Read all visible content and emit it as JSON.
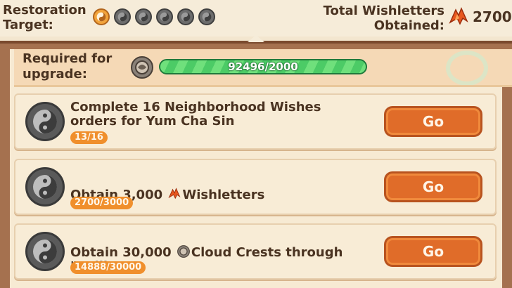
{
  "header": {
    "restoration_label": "Restoration\nTarget:",
    "orbs": [
      "active",
      "inactive",
      "inactive",
      "inactive",
      "inactive",
      "inactive"
    ],
    "total_label": "Total Wishletters\nObtained:",
    "total_value": "2700"
  },
  "requirement": {
    "label": "Required for\nupgrade:",
    "progress_text": "92496/2000",
    "progress_fraction": 1.0
  },
  "tasks": [
    {
      "title": "Complete 16 Neighborhood Wishes\norders for Yum Cha Sin",
      "progress": "13/16",
      "button": "Go"
    },
    {
      "title_before": "Obtain 3,000 ",
      "title_after": "Wishletters",
      "progress": "2700/3000",
      "button": "Go"
    },
    {
      "title_before": "Obtain 30,000 ",
      "title_after": "Cloud Crests through\n\"Selling\"",
      "progress": "14888/30000",
      "button": "Go"
    }
  ],
  "colors": {
    "accent_orange": "#e06c29",
    "progress_green": "#37b35a",
    "panel_brown": "#a5714f"
  },
  "icons": {
    "orb": "yin-yang-orb-icon",
    "wishletter": "wishletter-icon",
    "cloud_crest": "cloud-crest-icon"
  }
}
